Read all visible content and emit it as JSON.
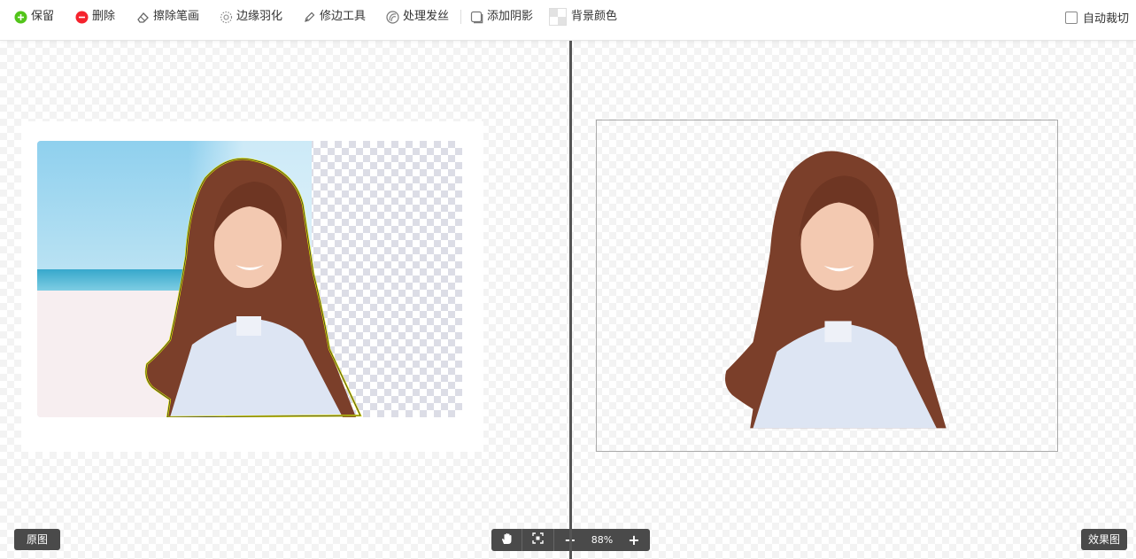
{
  "toolbar": {
    "keep": "保留",
    "delete": "删除",
    "erase_brush": "擦除笔画",
    "edge_feather": "边缘羽化",
    "edge_tool": "修边工具",
    "hair": "处理发丝",
    "add_shadow": "添加阴影",
    "bg_color": "背景颜色",
    "auto_crop": "自动裁切"
  },
  "colors": {
    "keep_green": "#52c41a",
    "delete_red": "#f5222d",
    "outline_yellow": "#e6e600",
    "pill_bg": "#4a4a4a"
  },
  "labels": {
    "original": "原图",
    "result": "效果图"
  },
  "zoom": {
    "value": "88%",
    "hand_icon": "hand-icon",
    "fit_icon": "fit-screen-icon",
    "zoom_out": "−",
    "zoom_in": "+"
  }
}
